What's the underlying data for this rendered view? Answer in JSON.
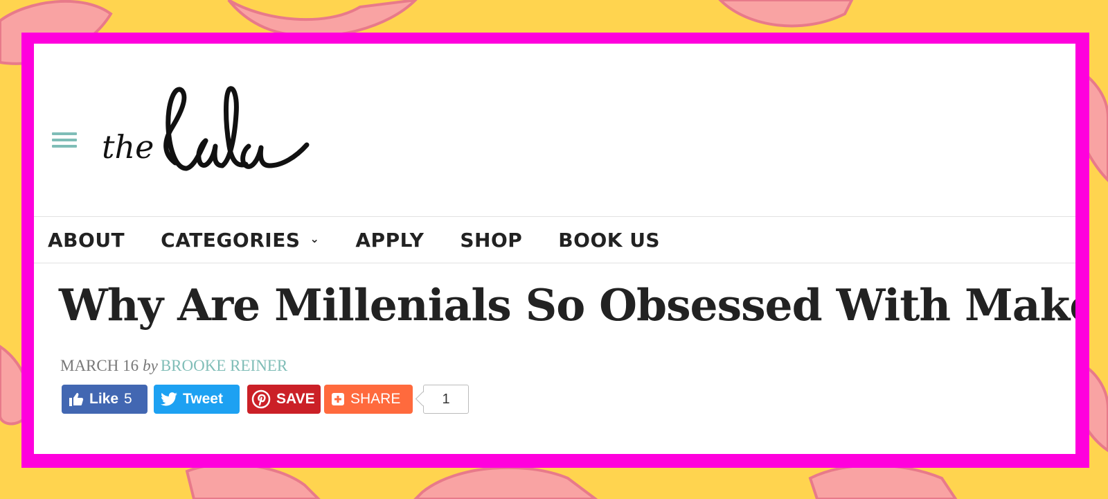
{
  "site": {
    "logo_small": "the",
    "logo_script": "lala"
  },
  "nav": {
    "items": [
      {
        "label": "ABOUT"
      },
      {
        "label": "CATEGORIES",
        "has_dropdown": true
      },
      {
        "label": "APPLY"
      },
      {
        "label": "SHOP"
      },
      {
        "label": "BOOK US"
      }
    ]
  },
  "article": {
    "title": "Why Are Millenials So Obsessed With Makeup?",
    "date": "MARCH 16",
    "by": "by",
    "author": "BROOKE REINER"
  },
  "share": {
    "facebook_label": "Like",
    "facebook_count": "5",
    "twitter_label": "Tweet",
    "pinterest_label": "SAVE",
    "share_label": "SHARE",
    "share_count": "1"
  },
  "colors": {
    "frame": "#ff00dd",
    "background": "#ffd44f",
    "accent": "#7fbdb7",
    "facebook": "#4267b2",
    "twitter": "#1da1f2",
    "pinterest": "#cb2027",
    "share": "#ff6a3d"
  },
  "icons": [
    "menu-icon",
    "chevron-down-icon",
    "thumbs-up-icon",
    "twitter-bird-icon",
    "pinterest-icon",
    "plus-box-icon"
  ]
}
